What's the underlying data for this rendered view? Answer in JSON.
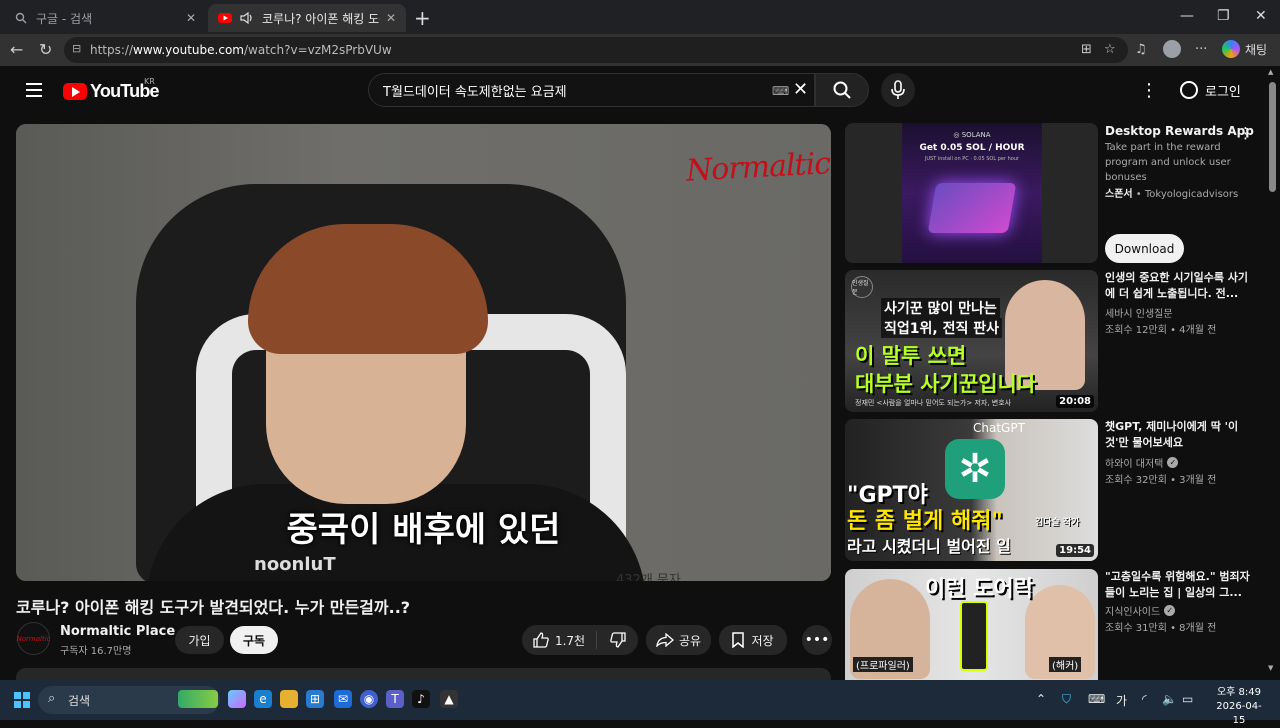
{
  "browser": {
    "tabs": [
      {
        "label": "구글 - 검색",
        "active": false
      },
      {
        "label": "코루나? 아이폰 해킹 도구가 발견",
        "active": true
      }
    ],
    "url_prefix": "https://",
    "url_host": "www.youtube.com",
    "url_path": "/watch?v=vzM2sPrbVUw",
    "chat_label": "채팅"
  },
  "header": {
    "logo_text": "YouTube",
    "region": "KR",
    "search_value": "T월드데이터 속도제한없는 요금제",
    "login_label": "로그인"
  },
  "player": {
    "watermark": "Normaltic",
    "subtitle": "중국이 배후에 있던",
    "shirt_text": "noonluT",
    "overlay_text": "432개 문자"
  },
  "video": {
    "title": "코루나? 아이폰 해킹 도구가 발견되었다. 누가 만든걸까..?",
    "channel": "Normaltic Place",
    "avatar_text": "Normaltic",
    "subscribers": "구독자 16.7만명",
    "join_label": "가입",
    "subscribe_label": "구독",
    "likes": "1.7천",
    "share_label": "공유",
    "save_label": "저장"
  },
  "ad": {
    "thumb_brand": "◎ SOLANA",
    "thumb_headline": "Get 0.05 SOL / HOUR",
    "thumb_sub": "JUST install on PC · 0.05 SOL per hour",
    "title": "Desktop Rewards App",
    "description": "Take part in the reward program and unlock user bonuses",
    "sponsor_label": "스폰서",
    "sponsor_name": "Tokyologicadvisors",
    "download_label": "Download"
  },
  "recommendations": [
    {
      "title": "인생의 중요한 시기일수록 사기에 더 쉽게 노출됩니다. 전...",
      "channel": "세바시 인생질문",
      "meta": "조회수 12만회 • 4개월 전",
      "duration": "20:08",
      "verified": false,
      "thumb": {
        "tag": "인생질문",
        "line1": "사기꾼 많이 만나는",
        "line2": "직업1위, 전직 판사",
        "line3": "이 말투 쓰면",
        "line4": "대부분 사기꾼입니다",
        "caption": "정재민 <사람을 얼마나 믿어도 되는가> 저자, 변호사"
      }
    },
    {
      "title": "챗GPT, 제미나이에게 딱 '이것'만 물어보세요",
      "channel": "하와이 대저택",
      "meta": "조회수 32만회 • 3개월 전",
      "duration": "19:54",
      "verified": true,
      "thumb": {
        "brand": "ChatGPT",
        "line1": "\"GPT야",
        "line2": "돈 좀 벌게 해줘\"",
        "line3": "라고 시켰더니 벌어진 일",
        "name": "김다슬 작가"
      }
    },
    {
      "title": "\"고층일수록 위험해요.\" 범죄자들이 노리는 집 | 일상의 그...",
      "channel": "지식인사이드",
      "meta": "조회수 31만회 • 8개월 전",
      "duration": "",
      "verified": true,
      "thumb": {
        "line1": "이런 도어락",
        "cap1": "(프로파일러)",
        "cap2": "(해커)"
      }
    }
  ],
  "taskbar": {
    "search_label": "검색",
    "ime": "가",
    "time": "오후 8:49",
    "date": "2026-04-15"
  },
  "colors": {
    "yt_red": "#ff0000",
    "bg": "#0f0f0f",
    "accent_green": "#b6ff2a"
  }
}
